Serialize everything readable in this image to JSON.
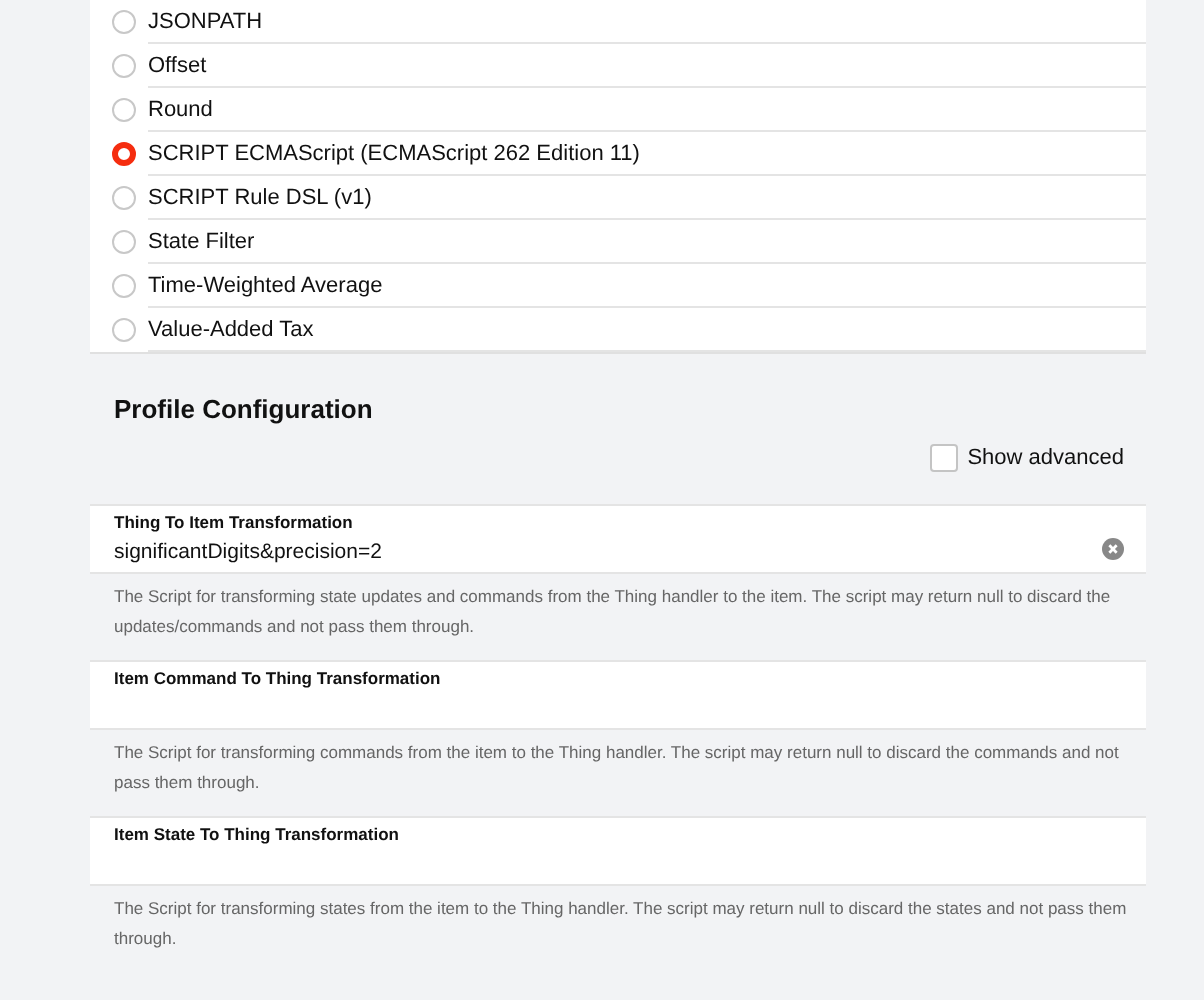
{
  "transformations": [
    {
      "label": "JSONPATH",
      "selected": false
    },
    {
      "label": "Offset",
      "selected": false
    },
    {
      "label": "Round",
      "selected": false
    },
    {
      "label": "SCRIPT ECMAScript (ECMAScript 262 Edition 11)",
      "selected": true
    },
    {
      "label": "SCRIPT Rule DSL (v1)",
      "selected": false
    },
    {
      "label": "State Filter",
      "selected": false
    },
    {
      "label": "Time-Weighted Average",
      "selected": false
    },
    {
      "label": "Value-Added Tax",
      "selected": false
    }
  ],
  "profile_configuration": {
    "title": "Profile Configuration",
    "show_advanced": {
      "label": "Show advanced",
      "checked": false
    },
    "fields": [
      {
        "label": "Thing To Item Transformation",
        "value": "significantDigits&precision=2",
        "description": "The Script for transforming state updates and commands from the Thing handler to the item. The script may return null to discard the updates/commands and not pass them through."
      },
      {
        "label": "Item Command To Thing Transformation",
        "description": "The Script for transforming commands from the item to the Thing handler. The script may return null to discard the commands and not pass them through."
      },
      {
        "label": "Item State To Thing Transformation",
        "description": "The Script for transforming states from the item to the Thing handler. The script may return null to discard the states and not pass them through."
      }
    ]
  }
}
